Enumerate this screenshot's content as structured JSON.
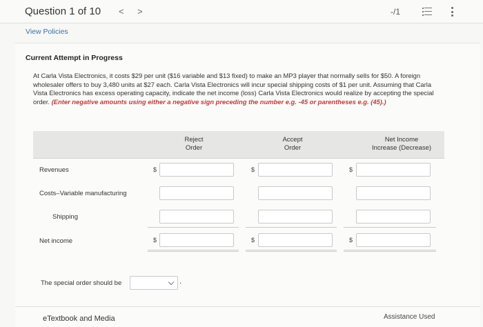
{
  "header": {
    "question_counter": "Question 1 of 10",
    "prev_glyph": "<",
    "next_glyph": ">",
    "score": "-/1",
    "list_icon": "list-icon",
    "more_icon": "more-vertical-icon"
  },
  "links": {
    "view_policies": "View Policies"
  },
  "attempt": {
    "status": "Current Attempt in Progress",
    "problem_text": "At Carla Vista Electronics, it costs $29 per unit ($16 variable and $13 fixed) to make an MP3 player that normally sells for $50. A foreign wholesaler offers to buy 3,480 units at $27 each. Carla Vista Electronics will incur special shipping costs of $1 per unit. Assuming that Carla Vista Electronics has excess operating capacity, indicate the net income (loss) Carla Vista Electronics would realize by accepting the special order.",
    "instruction": "(Enter negative amounts using either a negative sign preceding the number e.g. -45 or parentheses e.g. (45).)"
  },
  "table": {
    "columns": [
      {
        "line1": "Reject",
        "line2": "Order"
      },
      {
        "line1": "Accept",
        "line2": "Order"
      },
      {
        "line1": "Net Income",
        "line2": "Increase (Decrease)"
      }
    ],
    "rows": [
      {
        "label": "Revenues",
        "currency": "$"
      },
      {
        "label": "Costs–Variable manufacturing",
        "currency": ""
      },
      {
        "label": "Shipping",
        "currency": ""
      },
      {
        "label": "Net income",
        "currency": "$"
      }
    ]
  },
  "decision": {
    "label": "The special order should be",
    "selected": "",
    "period": "."
  },
  "footer": {
    "etextbook": "eTextbook and Media",
    "assistance": "Assistance Used"
  },
  "colors": {
    "instruction": "#b5403e",
    "link": "#3d6fa6",
    "header_band": "#e6e6e4"
  }
}
